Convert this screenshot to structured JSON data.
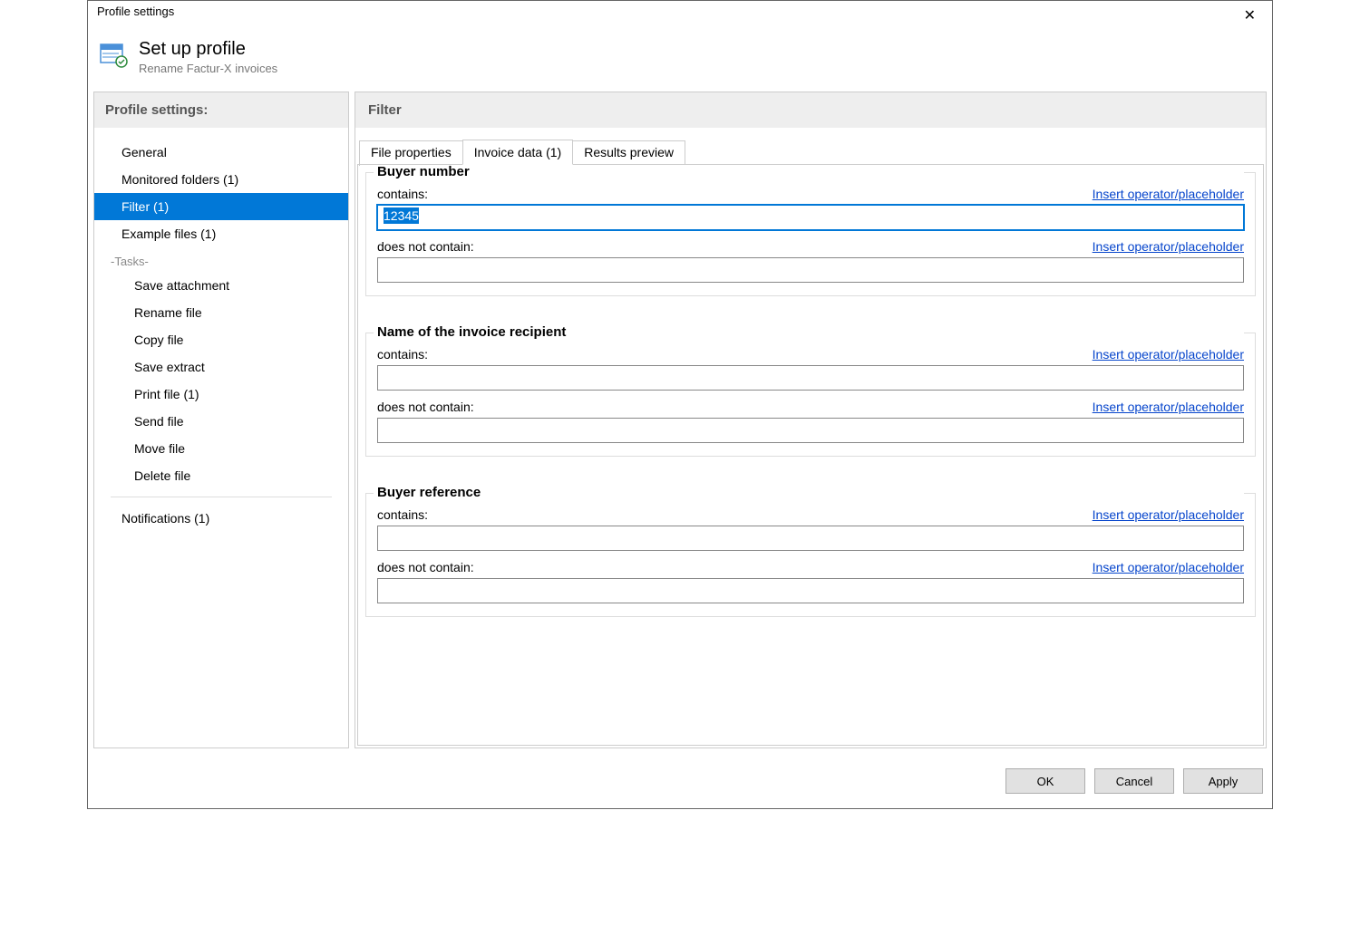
{
  "window": {
    "title": "Profile settings"
  },
  "header": {
    "title": "Set up profile",
    "subtitle": "Rename Factur-X invoices"
  },
  "sidebar": {
    "title": "Profile settings:",
    "items": [
      {
        "label": "General"
      },
      {
        "label": "Monitored folders (1)"
      },
      {
        "label": "Filter (1)",
        "selected": true
      },
      {
        "label": "Example files (1)"
      }
    ],
    "tasks_label": "-Tasks-",
    "tasks": [
      {
        "label": "Save attachment"
      },
      {
        "label": "Rename file"
      },
      {
        "label": "Copy file"
      },
      {
        "label": "Save extract"
      },
      {
        "label": "Print file (1)"
      },
      {
        "label": "Send file"
      },
      {
        "label": "Move file"
      },
      {
        "label": "Delete file"
      }
    ],
    "footer_item": {
      "label": "Notifications (1)"
    }
  },
  "main": {
    "title": "Filter",
    "tabs": [
      {
        "label": "File properties"
      },
      {
        "label": "Invoice data (1)",
        "active": true
      },
      {
        "label": "Results preview"
      }
    ],
    "labels": {
      "contains": "contains:",
      "does_not_contain": "does not contain:",
      "insert_link": "Insert operator/placeholder"
    },
    "groups": [
      {
        "legend": "Buyer number",
        "contains_value": "12345",
        "contains_selected": true,
        "not_contains_value": ""
      },
      {
        "legend": "Name of the invoice recipient",
        "contains_value": "",
        "not_contains_value": ""
      },
      {
        "legend": "Buyer reference",
        "contains_value": "",
        "not_contains_value": ""
      }
    ]
  },
  "footer": {
    "ok": "OK",
    "cancel": "Cancel",
    "apply": "Apply"
  }
}
